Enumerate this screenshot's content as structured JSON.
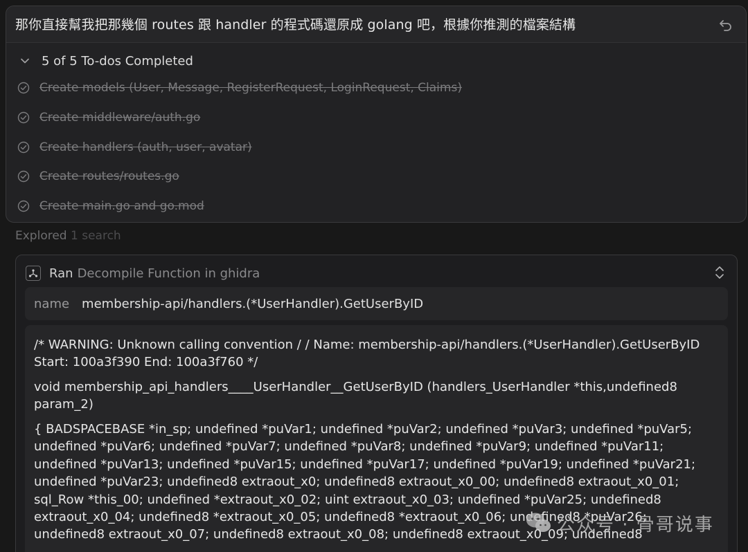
{
  "prompt": {
    "text": "那你直接幫我把那幾個 routes 跟 handler 的程式碼還原成 golang 吧，根據你推測的檔案結構"
  },
  "todos": {
    "title": "5 of 5 To-dos Completed",
    "items": [
      {
        "label": "Create models (User, Message, RegisterRequest, LoginRequest, Claims)",
        "done": true
      },
      {
        "label": "Create middleware/auth.go",
        "done": true
      },
      {
        "label": "Create handlers (auth, user, avatar)",
        "done": true
      },
      {
        "label": "Create routes/routes.go",
        "done": true
      },
      {
        "label": "Create main.go and go.mod",
        "done": true
      }
    ]
  },
  "explored": {
    "prefix": "Explored",
    "count": "1 search"
  },
  "tool_call": {
    "status": "Ran",
    "description": "Decompile Function in ghidra",
    "param_key": "name",
    "param_value": "membership-api/handlers.(*UserHandler).GetUserByID",
    "output": [
      "/* WARNING: Unknown calling convention / / Name: membership-api/handlers.(*UserHandler).GetUserByID Start: 100a3f390 End: 100a3f760 */",
      "void membership_api_handlers____UserHandler__GetUserByID (handlers_UserHandler *this,undefined8 param_2)",
      "{ BADSPACEBASE *in_sp; undefined *puVar1; undefined *puVar2; undefined *puVar3; undefined *puVar5; undefined *puVar6; undefined *puVar7; undefined *puVar8; undefined *puVar9; undefined *puVar11; undefined *puVar13; undefined *puVar15; undefined *puVar17; undefined *puVar19; undefined *puVar21; undefined *puVar23; undefined8 extraout_x0; undefined8 extraout_x0_00; undefined8 extraout_x0_01; sql_Row *this_00; undefined *extraout_x0_02; uint extraout_x0_03; undefined *puVar25; undefined8 extraout_x0_04; undefined8 *extraout_x0_05; undefined8 *extraout_x0_06; undefined8 *puVar26; undefined8 extraout_x0_07; undefined8 extraout_x0_08; undefined8 extraout_x0_09; undefined8"
    ]
  },
  "watermark": {
    "text": "公众号 · 骨哥说事"
  },
  "colors": {
    "background": "#181818",
    "panel": "#222224",
    "border": "#3a3a3c",
    "text": "#e6e6e6",
    "muted": "#7c7c7e"
  }
}
